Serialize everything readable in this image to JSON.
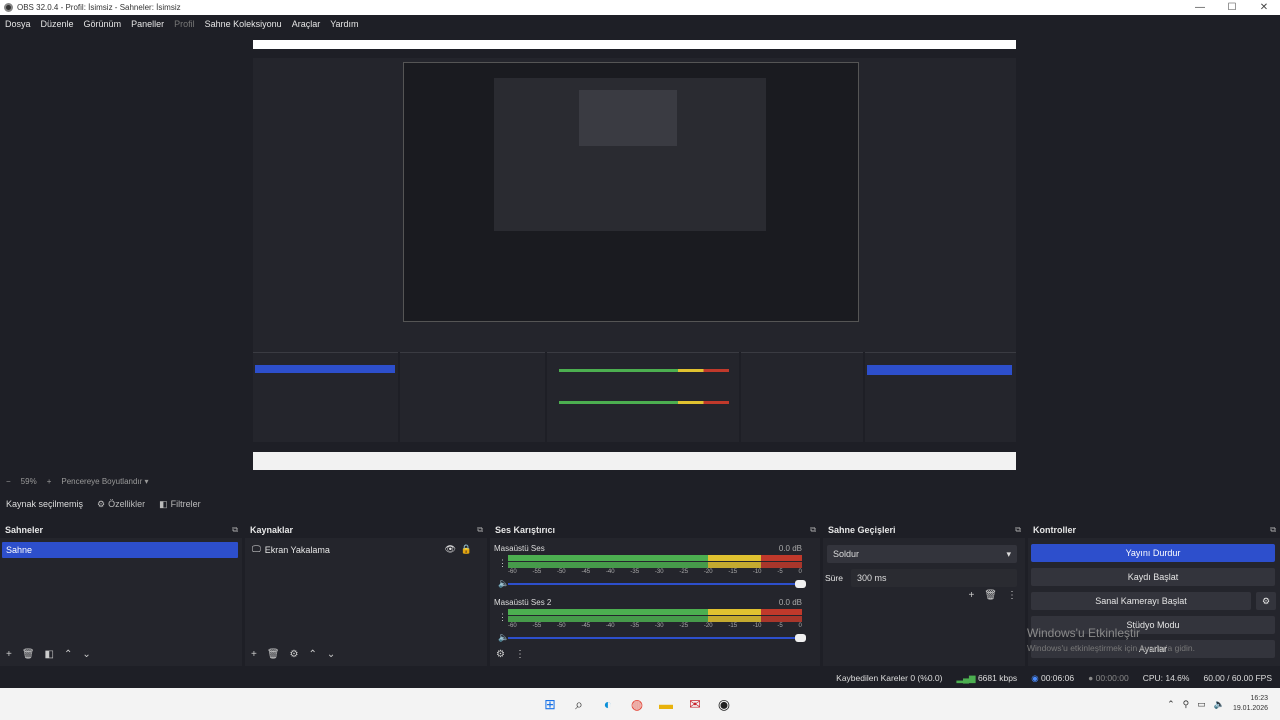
{
  "window": {
    "title": "OBS 32.0.4 - Profil: İsimsiz - Sahneler: İsimsiz",
    "minimize": "—",
    "maximize": "☐",
    "close": "✕"
  },
  "menu": [
    "Dosya",
    "Düzenle",
    "Görünüm",
    "Paneller",
    "Profil",
    "Sahne Koleksiyonu",
    "Araçlar",
    "Yardım"
  ],
  "zoom": {
    "minus": "−",
    "value": "59%",
    "plus": "+",
    "mode": "Pencereye Boyutlandır",
    "caret": "▾"
  },
  "source_bar": {
    "no_source": "Kaynak seçilmemiş",
    "properties": "Özellikler",
    "filters": "Filtreler"
  },
  "scenes": {
    "title": "Sahneler",
    "items": [
      "Sahne"
    ]
  },
  "sources": {
    "title": "Kaynaklar",
    "items": [
      "Ekran Yakalama"
    ]
  },
  "mixer": {
    "title": "Ses Karıştırıcı",
    "channels": [
      {
        "name": "Masaüstü Ses",
        "db": "0.0 dB"
      },
      {
        "name": "Masaüstü Ses 2",
        "db": "0.0 dB"
      }
    ],
    "scale": [
      "-60",
      "-55",
      "-50",
      "-45",
      "-40",
      "-35",
      "-30",
      "-25",
      "-20",
      "-15",
      "-10",
      "-5",
      "0"
    ]
  },
  "transitions": {
    "title": "Sahne Geçişleri",
    "selected": "Soldur",
    "duration_label": "Süre",
    "duration": "300 ms"
  },
  "controls": {
    "title": "Kontroller",
    "stop_stream": "Yayını Durdur",
    "start_record": "Kaydı Başlat",
    "virtual_cam": "Sanal Kamerayı Başlat",
    "studio_mode": "Stüdyo Modu",
    "settings": "Ayarlar"
  },
  "status": {
    "dropped": "Kaybedilen Kareler 0 (%0.0)",
    "bitrate": "6681 kbps",
    "stream_time": "00:06:06",
    "rec_time": "00:00:00",
    "cpu": "CPU: 14.6%",
    "fps": "60.00 / 60.00 FPS"
  },
  "watermark": {
    "line1": "Windows'u Etkinleştir",
    "line2": "Windows'u etkinleştirmek için Ayarlar'a gidin."
  },
  "clock": {
    "time": "16:23",
    "date": "19.01.2026"
  }
}
